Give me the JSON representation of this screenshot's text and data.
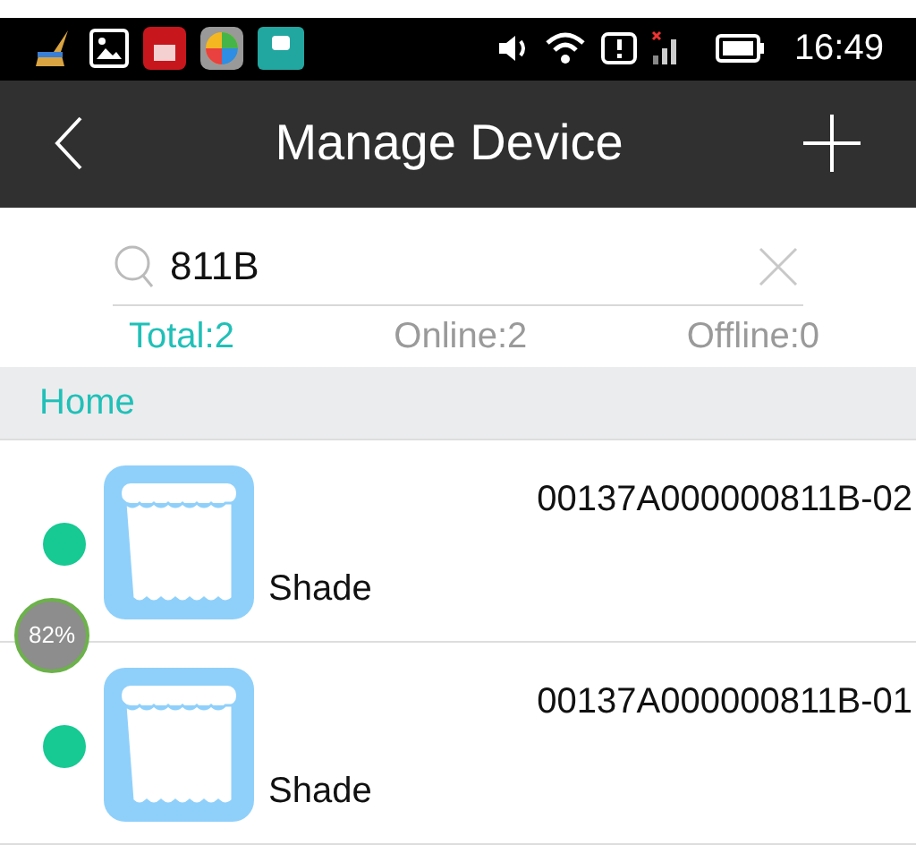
{
  "status_bar": {
    "time": "16:49"
  },
  "header": {
    "title": "Manage Device"
  },
  "search": {
    "value": "811B"
  },
  "counts": [
    {
      "label": "Total:",
      "value": "2",
      "selected": true
    },
    {
      "label": "Online:",
      "value": "2",
      "selected": false
    },
    {
      "label": "Offline:",
      "value": "0",
      "selected": false
    }
  ],
  "group": {
    "name": "Home"
  },
  "devices": [
    {
      "id": "00137A000000811B-02",
      "type": "Shade",
      "online": true
    },
    {
      "id": "00137A000000811B-01",
      "type": "Shade",
      "online": true
    }
  ],
  "floating_badge": {
    "text": "82%"
  }
}
